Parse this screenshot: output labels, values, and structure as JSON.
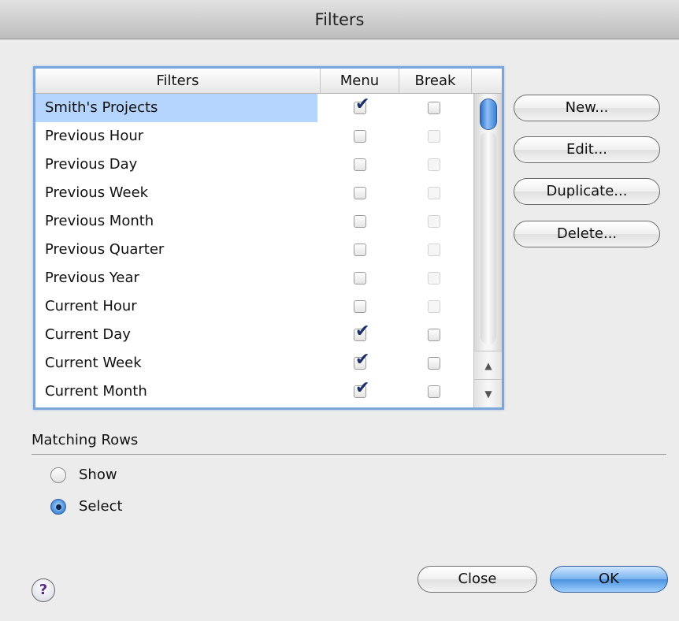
{
  "window": {
    "title": "Filters"
  },
  "table": {
    "columns": [
      "Filters",
      "Menu",
      "Break"
    ],
    "rows": [
      {
        "name": "Smith's Projects",
        "menu": true,
        "break": false,
        "menu_enabled": true,
        "break_enabled": true,
        "selected": true
      },
      {
        "name": "Previous Hour",
        "menu": false,
        "break": false,
        "menu_enabled": true,
        "break_enabled": false,
        "selected": false
      },
      {
        "name": "Previous Day",
        "menu": false,
        "break": false,
        "menu_enabled": true,
        "break_enabled": false,
        "selected": false
      },
      {
        "name": "Previous Week",
        "menu": false,
        "break": false,
        "menu_enabled": true,
        "break_enabled": false,
        "selected": false
      },
      {
        "name": "Previous Month",
        "menu": false,
        "break": false,
        "menu_enabled": true,
        "break_enabled": false,
        "selected": false
      },
      {
        "name": "Previous Quarter",
        "menu": false,
        "break": false,
        "menu_enabled": true,
        "break_enabled": false,
        "selected": false
      },
      {
        "name": "Previous Year",
        "menu": false,
        "break": false,
        "menu_enabled": true,
        "break_enabled": false,
        "selected": false
      },
      {
        "name": "Current Hour",
        "menu": false,
        "break": false,
        "menu_enabled": true,
        "break_enabled": false,
        "selected": false
      },
      {
        "name": "Current Day",
        "menu": true,
        "break": false,
        "menu_enabled": true,
        "break_enabled": true,
        "selected": false
      },
      {
        "name": "Current Week",
        "menu": true,
        "break": false,
        "menu_enabled": true,
        "break_enabled": true,
        "selected": false
      },
      {
        "name": "Current Month",
        "menu": true,
        "break": false,
        "menu_enabled": true,
        "break_enabled": true,
        "selected": false
      }
    ]
  },
  "side_buttons": {
    "new_label": "New...",
    "edit_label": "Edit...",
    "duplicate_label": "Duplicate...",
    "delete_label": "Delete..."
  },
  "matching_rows": {
    "title": "Matching Rows",
    "options": [
      {
        "label": "Show",
        "selected": false
      },
      {
        "label": "Select",
        "selected": true
      }
    ]
  },
  "footer": {
    "help_label": "?",
    "close_label": "Close",
    "ok_label": "OK"
  },
  "colors": {
    "selection": "#b5d5ff",
    "focus_ring": "#7aa6dc",
    "default_button": "#4b92df"
  }
}
